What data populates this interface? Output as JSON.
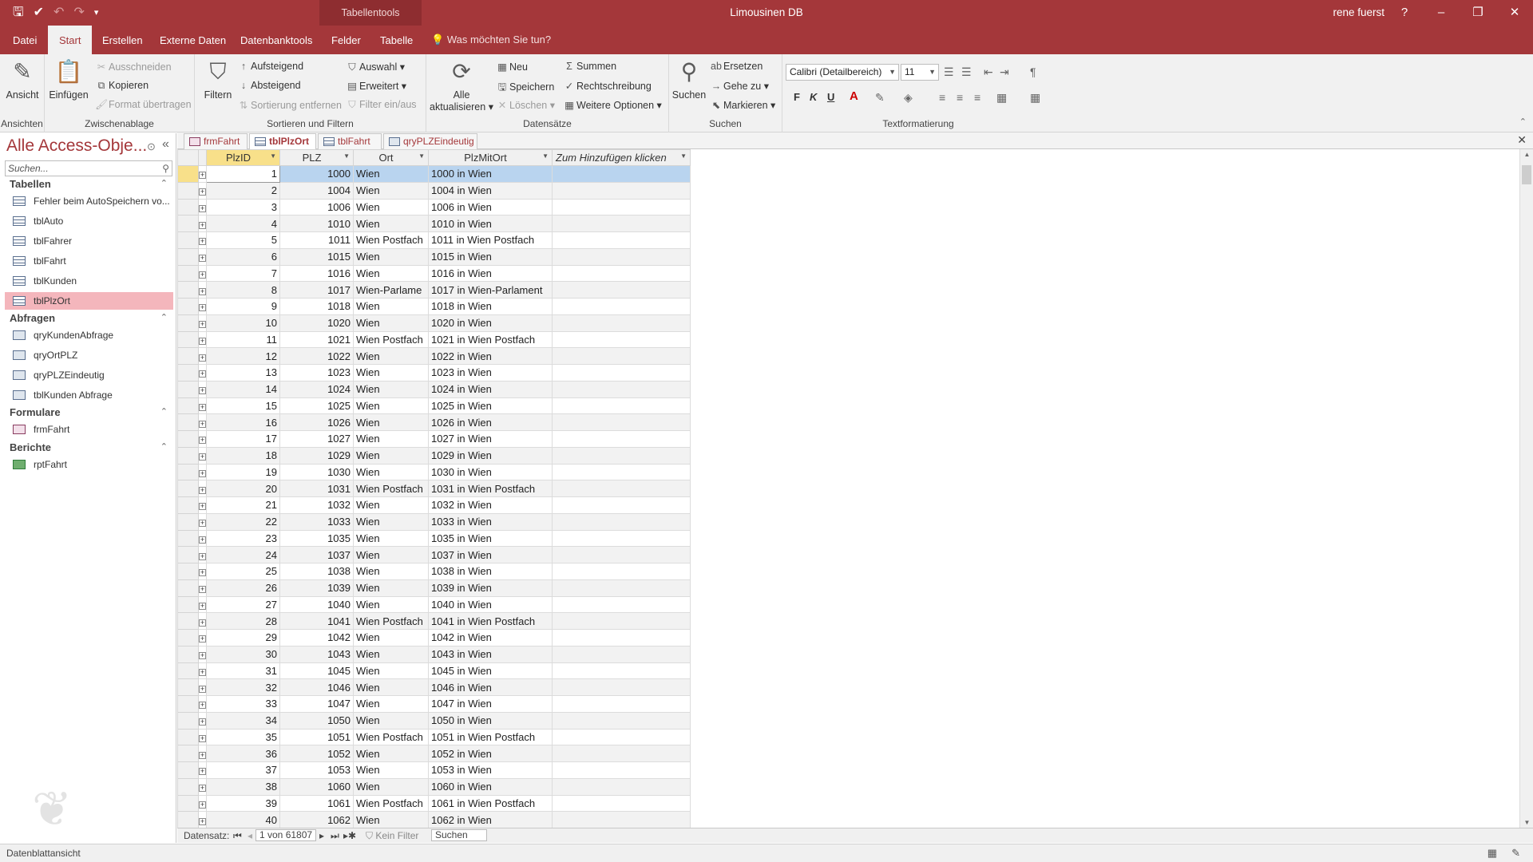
{
  "title_bar": {
    "context_tab": "Tabellentools",
    "app_title": "Limousinen DB",
    "user": "rene fuerst",
    "help": "?"
  },
  "ribbon_tabs": [
    "Datei",
    "Start",
    "Erstellen",
    "Externe Daten",
    "Datenbanktools",
    "Felder",
    "Tabelle"
  ],
  "tell_me": "Was möchten Sie tun?",
  "ribbon": {
    "ansichten": {
      "label": "Ansichten",
      "ansicht": "Ansicht"
    },
    "zwischenablage": {
      "label": "Zwischenablage",
      "einfuegen": "Einfügen",
      "ausschneiden": "Ausschneiden",
      "kopieren": "Kopieren",
      "format": "Format übertragen"
    },
    "sortieren": {
      "label": "Sortieren und Filtern",
      "filtern": "Filtern",
      "aufsteigend": "Aufsteigend",
      "absteigend": "Absteigend",
      "entfernen": "Sortierung entfernen",
      "auswahl": "Auswahl",
      "erweitert": "Erweitert",
      "filter_einaus": "Filter ein/aus"
    },
    "datensaetze": {
      "label": "Datensätze",
      "alle": "Alle",
      "aktualisieren": "aktualisieren",
      "neu": "Neu",
      "speichern": "Speichern",
      "loeschen": "Löschen",
      "summen": "Summen",
      "rechtschreibung": "Rechtschreibung",
      "weitere": "Weitere Optionen"
    },
    "suchen": {
      "label": "Suchen",
      "suchen": "Suchen",
      "ersetzen": "Ersetzen",
      "gehezu": "Gehe zu",
      "markieren": "Markieren"
    },
    "text": {
      "label": "Textformatierung",
      "font": "Calibri (Detailbereich)",
      "size": "11",
      "bold": "F",
      "italic": "K",
      "underline": "U"
    }
  },
  "nav": {
    "title": "Alle Access-Obje...",
    "search_placeholder": "Suchen...",
    "sections": {
      "tabellen": "Tabellen",
      "abfragen": "Abfragen",
      "formulare": "Formulare",
      "berichte": "Berichte"
    },
    "tables": [
      "Fehler beim AutoSpeichern vo...",
      "tblAuto",
      "tblFahrer",
      "tblFahrt",
      "tblKunden",
      "tblPlzOrt"
    ],
    "queries": [
      "qryKundenAbfrage",
      "qryOrtPLZ",
      "qryPLZEindeutig",
      "tblKunden Abfrage"
    ],
    "forms": [
      "frmFahrt"
    ],
    "reports": [
      "rptFahrt"
    ]
  },
  "doc_tabs": [
    "frmFahrt",
    "tblPlzOrt",
    "tblFahrt",
    "qryPLZEindeutig"
  ],
  "grid": {
    "headers": [
      "PlzID",
      "PLZ",
      "Ort",
      "PlzMitOrt",
      "Zum Hinzufügen klicken"
    ],
    "rows": [
      [
        "1",
        "1000",
        "Wien",
        "1000 in Wien"
      ],
      [
        "2",
        "1004",
        "Wien",
        "1004 in Wien"
      ],
      [
        "3",
        "1006",
        "Wien",
        "1006 in Wien"
      ],
      [
        "4",
        "1010",
        "Wien",
        "1010 in Wien"
      ],
      [
        "5",
        "1011",
        "Wien Postfach",
        "1011 in Wien Postfach"
      ],
      [
        "6",
        "1015",
        "Wien",
        "1015 in Wien"
      ],
      [
        "7",
        "1016",
        "Wien",
        "1016 in Wien"
      ],
      [
        "8",
        "1017",
        "Wien-Parlame",
        "1017 in Wien-Parlament"
      ],
      [
        "9",
        "1018",
        "Wien",
        "1018 in Wien"
      ],
      [
        "10",
        "1020",
        "Wien",
        "1020 in Wien"
      ],
      [
        "11",
        "1021",
        "Wien Postfach",
        "1021 in Wien Postfach"
      ],
      [
        "12",
        "1022",
        "Wien",
        "1022 in Wien"
      ],
      [
        "13",
        "1023",
        "Wien",
        "1023 in Wien"
      ],
      [
        "14",
        "1024",
        "Wien",
        "1024 in Wien"
      ],
      [
        "15",
        "1025",
        "Wien",
        "1025 in Wien"
      ],
      [
        "16",
        "1026",
        "Wien",
        "1026 in Wien"
      ],
      [
        "17",
        "1027",
        "Wien",
        "1027 in Wien"
      ],
      [
        "18",
        "1029",
        "Wien",
        "1029 in Wien"
      ],
      [
        "19",
        "1030",
        "Wien",
        "1030 in Wien"
      ],
      [
        "20",
        "1031",
        "Wien Postfach",
        "1031 in Wien Postfach"
      ],
      [
        "21",
        "1032",
        "Wien",
        "1032 in Wien"
      ],
      [
        "22",
        "1033",
        "Wien",
        "1033 in Wien"
      ],
      [
        "23",
        "1035",
        "Wien",
        "1035 in Wien"
      ],
      [
        "24",
        "1037",
        "Wien",
        "1037 in Wien"
      ],
      [
        "25",
        "1038",
        "Wien",
        "1038 in Wien"
      ],
      [
        "26",
        "1039",
        "Wien",
        "1039 in Wien"
      ],
      [
        "27",
        "1040",
        "Wien",
        "1040 in Wien"
      ],
      [
        "28",
        "1041",
        "Wien Postfach",
        "1041 in Wien Postfach"
      ],
      [
        "29",
        "1042",
        "Wien",
        "1042 in Wien"
      ],
      [
        "30",
        "1043",
        "Wien",
        "1043 in Wien"
      ],
      [
        "31",
        "1045",
        "Wien",
        "1045 in Wien"
      ],
      [
        "32",
        "1046",
        "Wien",
        "1046 in Wien"
      ],
      [
        "33",
        "1047",
        "Wien",
        "1047 in Wien"
      ],
      [
        "34",
        "1050",
        "Wien",
        "1050 in Wien"
      ],
      [
        "35",
        "1051",
        "Wien Postfach",
        "1051 in Wien Postfach"
      ],
      [
        "36",
        "1052",
        "Wien",
        "1052 in Wien"
      ],
      [
        "37",
        "1053",
        "Wien",
        "1053 in Wien"
      ],
      [
        "38",
        "1060",
        "Wien",
        "1060 in Wien"
      ],
      [
        "39",
        "1061",
        "Wien Postfach",
        "1061 in Wien Postfach"
      ],
      [
        "40",
        "1062",
        "Wien",
        "1062 in Wien"
      ]
    ]
  },
  "record_nav": {
    "label": "Datensatz:",
    "position": "1 von 61807",
    "filter": "Kein Filter",
    "search": "Suchen"
  },
  "status": {
    "text": "Datenblattansicht"
  },
  "colors": {
    "accent": "#a4373a",
    "selection": "#b9d4ef",
    "nav_selected": "#f4b6bc",
    "current_marker": "#f8e08a"
  }
}
